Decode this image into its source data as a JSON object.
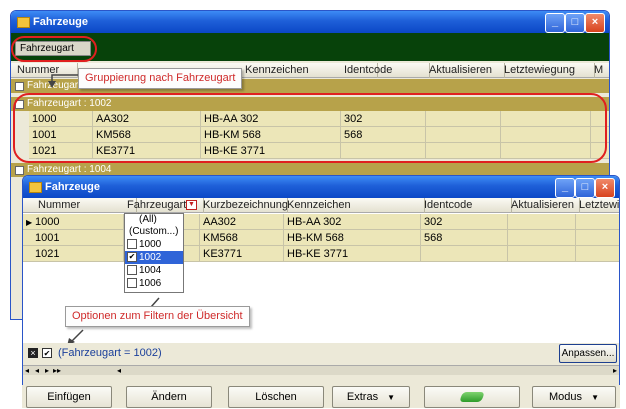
{
  "colors": {
    "accent": "#1e5fd8",
    "group_bg": "#b7a24a",
    "row_bg": "#e9e3b3",
    "highlight_red": "#e02020"
  },
  "back_window": {
    "title": "Fahrzeuge",
    "group_chip": "Fahrzeugart",
    "columns": [
      "Nummer",
      "Kennzeichen",
      "Identcode",
      "Aktualisieren",
      "Letztewiegung",
      "M"
    ],
    "groups": [
      {
        "label": "Fahrzeugart : 1001",
        "rows": []
      },
      {
        "label": "Fahrzeugart : 1002",
        "rows": [
          [
            "1000",
            "AA302",
            "HB-AA 302",
            "302",
            "",
            ""
          ],
          [
            "1001",
            "KM568",
            "HB-KM 568",
            "568",
            "",
            ""
          ],
          [
            "1021",
            "KE3771",
            "HB-KE 3771",
            "",
            "",
            ""
          ]
        ]
      },
      {
        "label": "Fahrzeugart : 1004",
        "rows": []
      }
    ]
  },
  "callout_group": "Gruppierung nach Fahrzeugart",
  "callout_filter": "Optionen zum Filtern der Übersicht",
  "front_window": {
    "title": "Fahrzeuge",
    "columns": [
      "Nummer",
      "Fahrzeugart",
      "Kurzbezeichnung",
      "Kennzeichen",
      "Identcode",
      "Aktualisieren",
      "Letztewie"
    ],
    "rows": [
      [
        "1000",
        "",
        "AA302",
        "HB-AA 302",
        "302",
        "",
        ""
      ],
      [
        "1001",
        "",
        "KM568",
        "HB-KM 568",
        "568",
        "",
        ""
      ],
      [
        "1021",
        "",
        "KE3771",
        "HB-KE 3771",
        "",
        "",
        ""
      ]
    ],
    "filter_options": [
      "(All)",
      "(Custom...)",
      "1000",
      "1002",
      "1004",
      "1006"
    ],
    "filter_text": "(Fahrzeugart = 1002)",
    "customize_button": "Anpassen..."
  },
  "toolbar": {
    "insert": "Einfügen",
    "change": "Ändern",
    "delete": "Löschen",
    "extras": "Extras",
    "mode": "Modus"
  }
}
